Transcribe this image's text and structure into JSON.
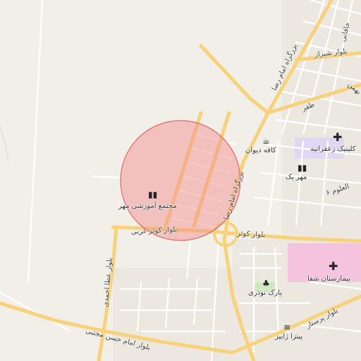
{
  "map": {
    "accent_circle_fill": "#f28a8a",
    "accent_circle_stroke": "#e06666",
    "major_road_color": "#f7d27a",
    "minor_road_color": "#ffffff",
    "hospital_area_color": "#f4c4df",
    "park_color": "#cfe8c2",
    "clinic_area_color": "#e0d7f2"
  },
  "pois": [
    {
      "name": "مجتمع آموزشی مهر",
      "icon": "school-icon"
    },
    {
      "name": "کافه دیوان",
      "icon": "cafe-icon"
    },
    {
      "name": "کلینیک زعفرانیه",
      "icon": "clinic-cross-icon"
    },
    {
      "name": "مهر یک",
      "icon": "school-icon"
    },
    {
      "name": "بیمارستان شفا",
      "icon": "hospital-cross-icon"
    },
    {
      "name": "پارک نوذری",
      "icon": "tree-icon"
    },
    {
      "name": "پیتزا ژابیز",
      "icon": "fast-food-icon"
    }
  ],
  "roads": [
    {
      "name": "بلوار کوثر غربی"
    },
    {
      "name": "بلوار کوثر"
    },
    {
      "name": "بزرگراه امام رضا"
    },
    {
      "name": "بزرگراه امام رضا"
    },
    {
      "name": "بلوار عطا احمدی"
    },
    {
      "name": "بلوار امام حسن مجتبی"
    },
    {
      "name": "بلوار پرستار"
    },
    {
      "name": "بلوار شیراز"
    },
    {
      "name": "ظفر"
    },
    {
      "name": "العلوم ۶"
    },
    {
      "name": "بهمن"
    },
    {
      "name": "خاقانی"
    }
  ]
}
